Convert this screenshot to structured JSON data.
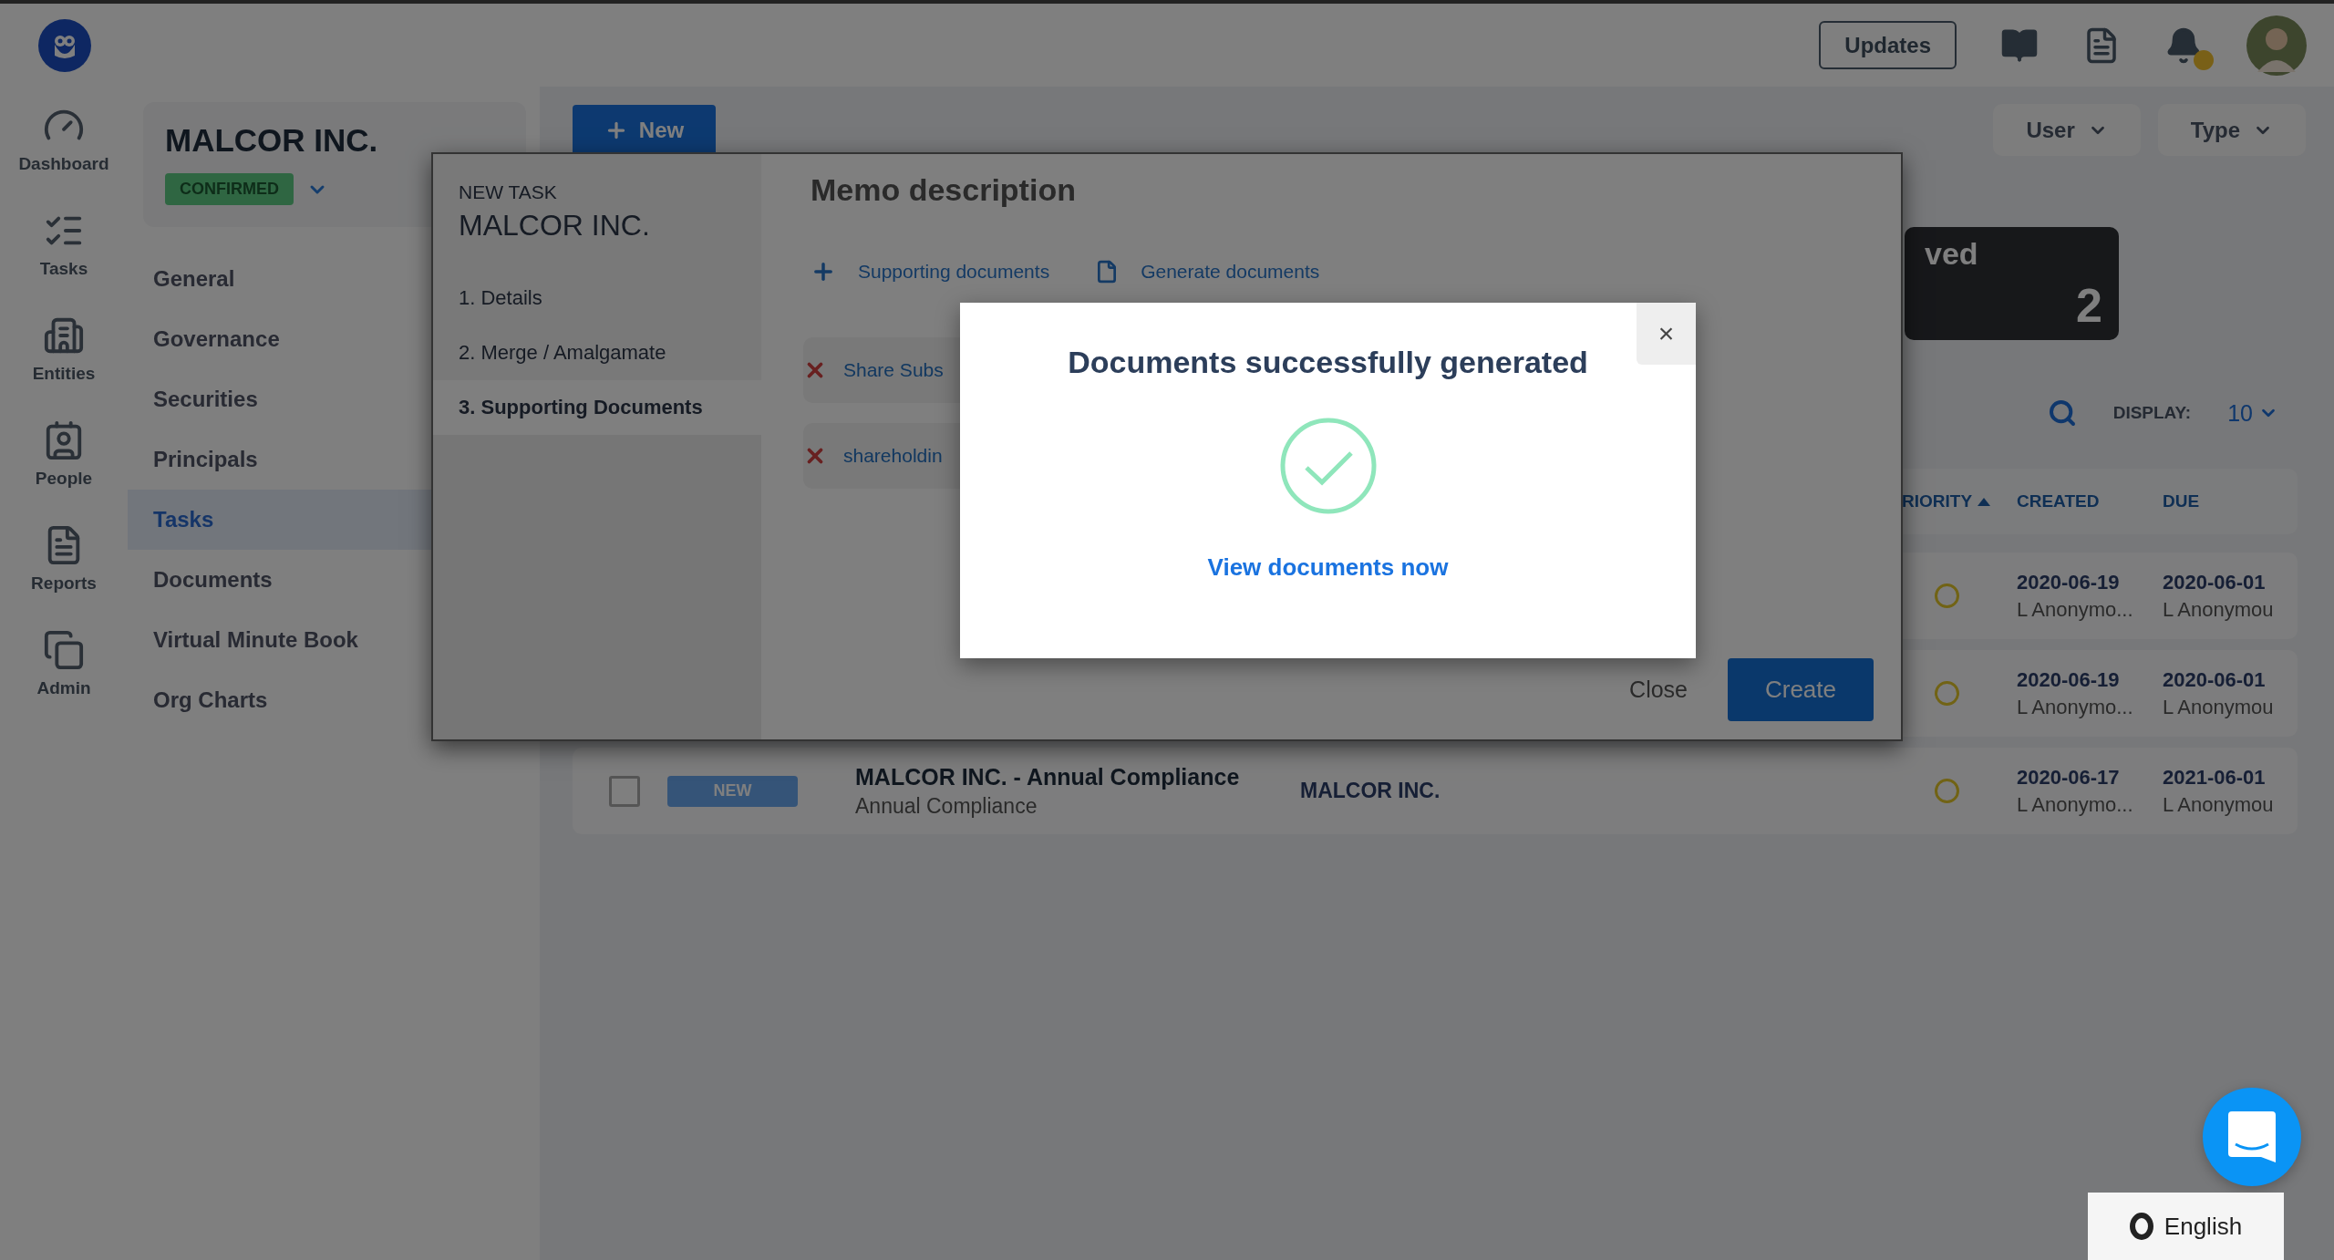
{
  "topbar": {
    "updates": "Updates"
  },
  "rail": [
    {
      "label": "Dashboard"
    },
    {
      "label": "Tasks"
    },
    {
      "label": "Entities"
    },
    {
      "label": "People"
    },
    {
      "label": "Reports"
    },
    {
      "label": "Admin"
    }
  ],
  "entity": {
    "name": "MALCOR INC.",
    "status": "CONFIRMED"
  },
  "nav": [
    {
      "label": "General",
      "selected": false
    },
    {
      "label": "Governance",
      "selected": false
    },
    {
      "label": "Securities",
      "selected": false
    },
    {
      "label": "Principals",
      "selected": false
    },
    {
      "label": "Tasks",
      "selected": true
    },
    {
      "label": "Documents",
      "selected": false
    },
    {
      "label": "Virtual Minute Book",
      "selected": false
    },
    {
      "label": "Org Charts",
      "selected": false
    }
  ],
  "new_button": "New",
  "filters": [
    "User",
    "Type"
  ],
  "stat_card": {
    "label": "ved",
    "value": "2"
  },
  "display": {
    "label": "DISPLAY:",
    "value": "10"
  },
  "table": {
    "columns": [
      {
        "label": "RIORITY",
        "sorted": true
      },
      {
        "label": "CREATED",
        "sorted": false
      },
      {
        "label": "DUE",
        "sorted": false
      }
    ],
    "rows": [
      {
        "created": "2020-06-19",
        "created_by": "L Anonymo...",
        "due": "2020-06-01",
        "due_by": "L Anonymou"
      },
      {
        "created": "2020-06-19",
        "created_by": "L Anonymo...",
        "due": "2020-06-01",
        "due_by": "L Anonymou"
      },
      {
        "checked": false,
        "status": "NEW",
        "title": "MALCOR INC. - Annual Compliance",
        "subtitle": "Annual Compliance",
        "entity": "MALCOR INC.",
        "created": "2020-06-17",
        "created_by": "L Anonymo...",
        "due": "2021-06-01",
        "due_by": "L Anonymou"
      }
    ]
  },
  "task_modal": {
    "eyebrow": "NEW TASK",
    "title": "MALCOR INC.",
    "steps": [
      {
        "label": "1. Details",
        "selected": false
      },
      {
        "label": "2. Merge / Amalgamate",
        "selected": false
      },
      {
        "label": "3. Supporting Documents",
        "selected": true
      }
    ],
    "heading": "Memo description",
    "actions": [
      {
        "kind": "add",
        "label": "Supporting documents"
      },
      {
        "kind": "generate",
        "label": "Generate documents"
      }
    ],
    "documents": [
      "Share Subs",
      "shareholdin"
    ],
    "close": "Close",
    "create": "Create"
  },
  "success_dialog": {
    "title": "Documents successfully generated",
    "link": "View documents now",
    "close": "×"
  },
  "language": "English"
}
